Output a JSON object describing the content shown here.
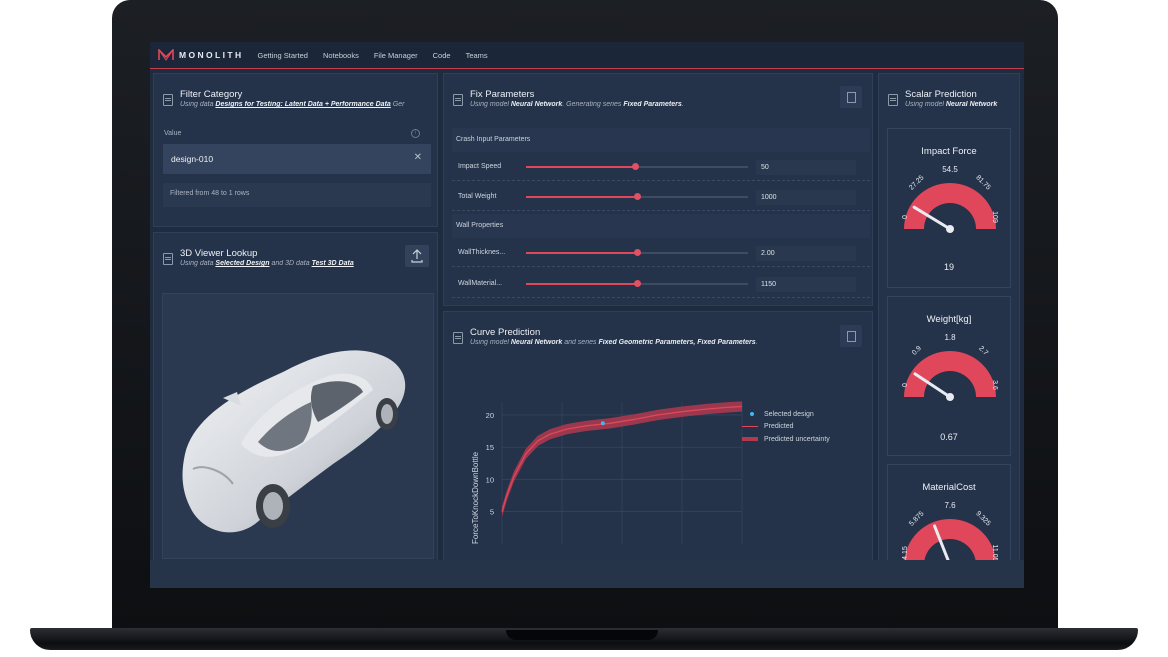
{
  "app": {
    "name": "MONOLITH",
    "nav": [
      "Getting Started",
      "Notebooks",
      "File Manager",
      "Code",
      "Teams"
    ]
  },
  "filter_category": {
    "title": "Filter Category",
    "subtitle_prefix": "Using data",
    "subtitle_link": "Designs for Testing: Latent Data + Performance Data",
    "subtitle_suffix": "Ger",
    "value_label": "Value",
    "value": "design-010",
    "filtered_text": "Filtered from 48 to 1 rows"
  },
  "viewer": {
    "title": "3D Viewer Lookup",
    "sub_using": "Using data",
    "sub_link1": "Selected Design",
    "sub_and": "and 3D data",
    "sub_link2": "Test 3D Data"
  },
  "fix_parameters": {
    "title": "Fix Parameters",
    "sub_using": "Using model",
    "sub_model": "Neural Network",
    "sub_gen": ". Generating series",
    "sub_series": "Fixed Parameters",
    "sections": [
      {
        "title": "Crash Input Parameters",
        "rows": [
          {
            "label": "Impact Speed",
            "value": "50",
            "fraction": 0.49
          },
          {
            "label": "Total Weight",
            "value": "1000",
            "fraction": 0.5
          }
        ]
      },
      {
        "title": "Wall Properties",
        "rows": [
          {
            "label": "WallThicknes...",
            "value": "2.00",
            "fraction": 0.5
          },
          {
            "label": "WallMaterial...",
            "value": "1150",
            "fraction": 0.5
          }
        ]
      }
    ]
  },
  "curve": {
    "title": "Curve Prediction",
    "sub_using": "Using model",
    "sub_model": "Neural Network",
    "sub_and": "and series",
    "sub_series1": "Fixed Geometric Parameters,",
    "sub_series2": "Fixed Parameters",
    "legend": [
      "Selected design",
      "Predicted",
      "Predicted uncertainty"
    ]
  },
  "chart_data": {
    "type": "line",
    "ylabel": "ForceToKnockDownBottle",
    "yticks": [
      "5",
      "10",
      "15",
      "20"
    ],
    "ylim": [
      0,
      22
    ],
    "x": [
      0,
      0.02,
      0.05,
      0.1,
      0.15,
      0.2,
      0.27,
      0.35,
      0.45,
      0.55,
      0.65,
      0.75,
      0.85,
      0.95,
      1.0
    ],
    "y": [
      5,
      7.5,
      10.5,
      14,
      16,
      17,
      17.8,
      18.3,
      18.7,
      19.3,
      20,
      20.5,
      20.9,
      21.2,
      21.3
    ],
    "uncertainty": 0.8,
    "selected_design": {
      "x": 0.42,
      "y": 18.7
    },
    "series": [
      {
        "name": "Predicted",
        "color": "#e0475a"
      },
      {
        "name": "Predicted uncertainty",
        "color": "#b13a4f"
      },
      {
        "name": "Selected design",
        "color": "#3fb8f0"
      }
    ],
    "grid": true,
    "legend_position": "top-right"
  },
  "scalar": {
    "title": "Scalar Prediction",
    "sub_using": "Using model",
    "sub_model": "Neural Network",
    "gauges": [
      {
        "title": "Impact Force",
        "min": "0",
        "q1": "27.25",
        "mid": "54.5",
        "q3": "81.75",
        "max": "109",
        "value": "19",
        "fraction": 0.174
      },
      {
        "title": "Weight[kg]",
        "min": "0",
        "q1": "0.9",
        "mid": "1.8",
        "q3": "2.7",
        "max": "3.6",
        "value": "0.67",
        "fraction": 0.186
      },
      {
        "title": "MaterialCost",
        "min": "4.15",
        "q1": "5.875",
        "mid": "7.6",
        "q3": "9.325",
        "max": "11.05",
        "value": "",
        "fraction": 0.38
      }
    ]
  },
  "colors": {
    "accent": "#e0475a",
    "panel": "#24324a",
    "background": "#1f2b3f"
  }
}
